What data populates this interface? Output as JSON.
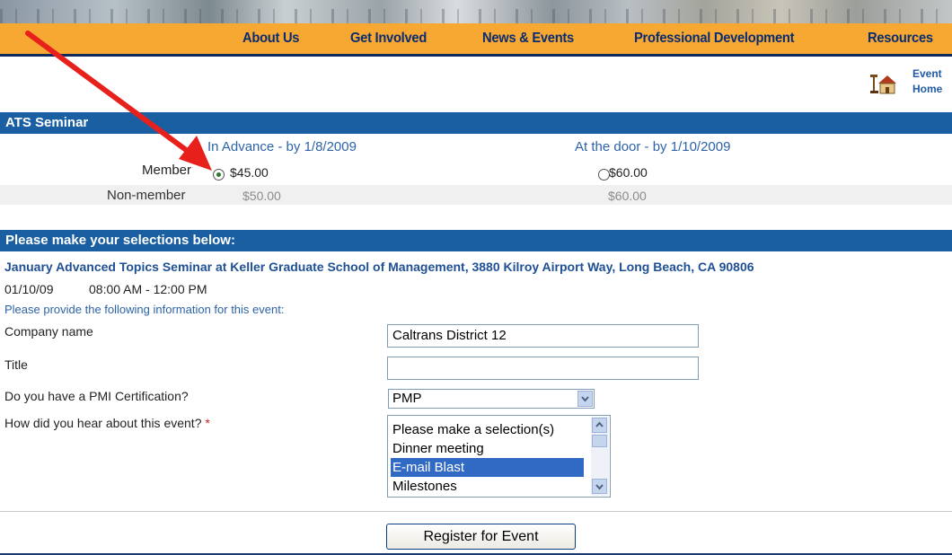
{
  "nav": {
    "items": [
      "About Us",
      "Get Involved",
      "News & Events",
      "Professional Development",
      "Resources"
    ]
  },
  "corner_links": {
    "line1": "Event",
    "line2": "Home"
  },
  "seminar": {
    "header": "ATS Seminar",
    "col_advance": "In Advance - by 1/8/2009",
    "col_door": "At the door - by 1/10/2009",
    "member_label": "Member",
    "member_advance": "$45.00",
    "member_door": "$60.00",
    "member_selected": "advance",
    "nonmember_label": "Non-member",
    "nonmember_advance": "$50.00",
    "nonmember_door": "$60.00"
  },
  "selections": {
    "header": "Please make your selections below:",
    "event_title": "January Advanced Topics Seminar at Keller Graduate School of Management, 3880 Kilroy Airport Way, Long Beach, CA 90806",
    "date": "01/10/09",
    "time": "08:00 AM - 12:00 PM",
    "info_prompt": "Please provide the following information for this event:",
    "company_label": "Company name",
    "company_value": "Caltrans District 12",
    "title_label": "Title",
    "title_value": "",
    "pmi_label": "Do you have a PMI Certification?",
    "pmi_value": "PMP",
    "hear_label": "How did you hear about this event?",
    "required_mark": "*",
    "hear_options": [
      "Please make a selection(s)",
      "Dinner meeting",
      "E-mail Blast",
      "Milestones"
    ],
    "hear_selected": "E-mail Blast",
    "register_button": "Register for Event"
  },
  "annotation": {
    "arrow_color": "#e8201c"
  },
  "colors": {
    "nav_bg": "#f7a833",
    "header_bar": "#1b5fa3",
    "link_blue": "#2d63a8"
  }
}
